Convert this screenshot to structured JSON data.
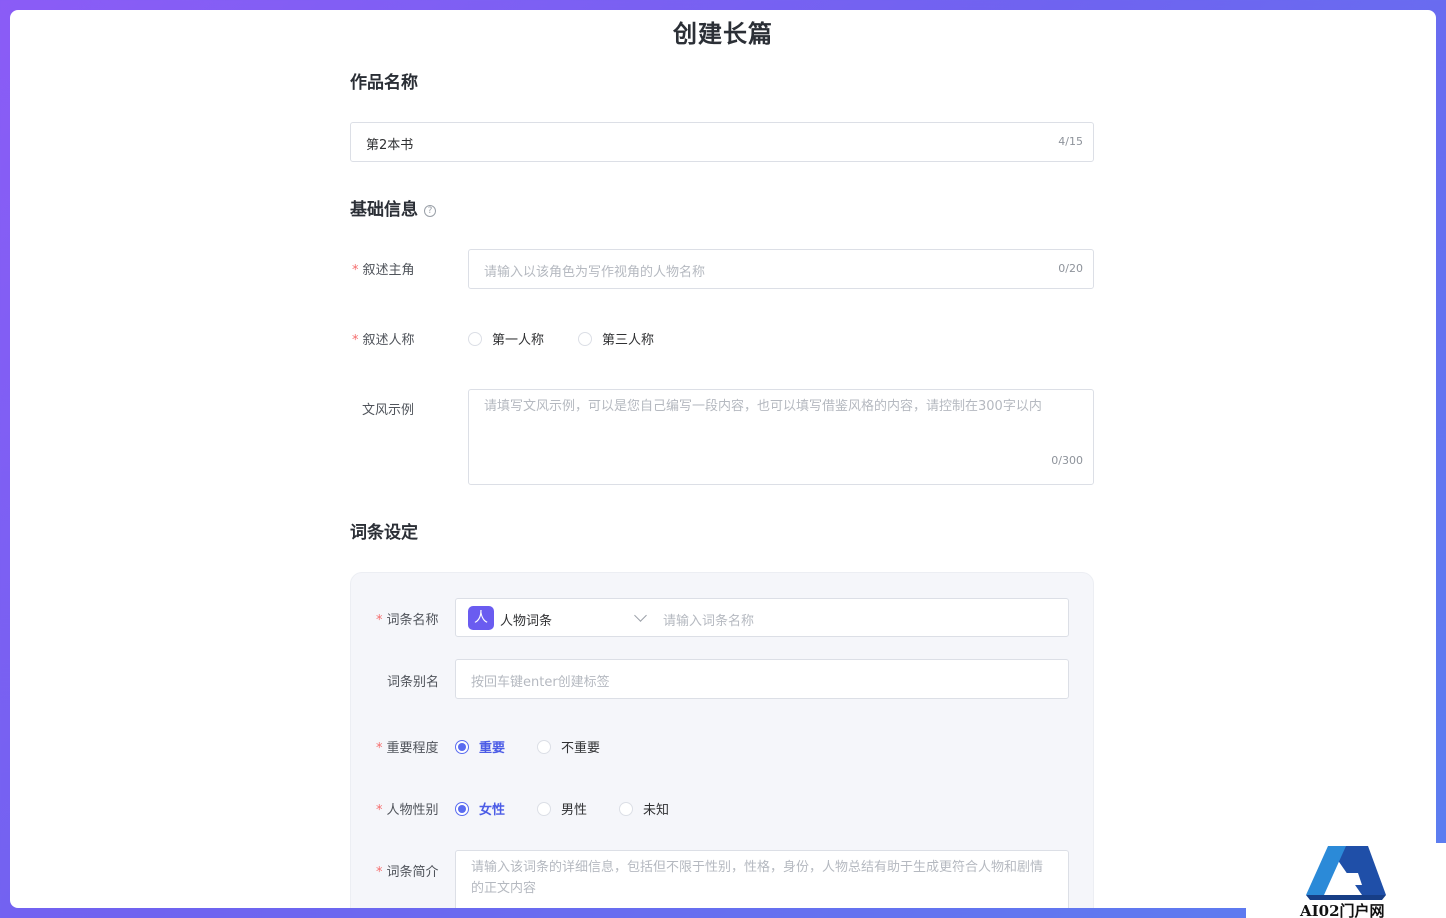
{
  "page": {
    "title": "创建长篇"
  },
  "work_name": {
    "section_title": "作品名称",
    "value": "第2本书",
    "count": "4/15"
  },
  "basic_info": {
    "section_title": "基础信息",
    "help_icon": "question-circle-icon",
    "protagonist": {
      "label": "叙述主角",
      "placeholder": "请输入以该角色为写作视角的人物名称",
      "count": "0/20"
    },
    "narrative_person": {
      "label": "叙述人称",
      "options": [
        "第一人称",
        "第三人称"
      ],
      "selected": null
    },
    "style_example": {
      "label": "文风示例",
      "placeholder": "请填写文风示例，可以是您自己编写一段内容，也可以填写借鉴风格的内容，请控制在300字以内",
      "count": "0/300"
    }
  },
  "entry_settings": {
    "section_title": "词条设定",
    "entry_name": {
      "label": "词条名称",
      "type_badge": "人",
      "type_value": "人物词条",
      "placeholder": "请输入词条名称"
    },
    "entry_alias": {
      "label": "词条别名",
      "placeholder": "按回车键enter创建标签"
    },
    "importance": {
      "label": "重要程度",
      "options": [
        "重要",
        "不重要"
      ],
      "selected": "重要"
    },
    "gender": {
      "label": "人物性别",
      "options": [
        "女性",
        "男性",
        "未知"
      ],
      "selected": "女性"
    },
    "intro": {
      "label": "词条简介",
      "placeholder": "请输入该词条的详细信息，包括但不限于性别，性格，身份，人物总结有助于生成更符合人物和剧情的正文内容"
    }
  },
  "watermark": {
    "text": "AI02门户网"
  },
  "colors": {
    "accent": "#5a6cf0",
    "required": "#f56c6c",
    "background_gradient_start": "#8b5cf6",
    "background_gradient_end": "#5b7ff0"
  }
}
